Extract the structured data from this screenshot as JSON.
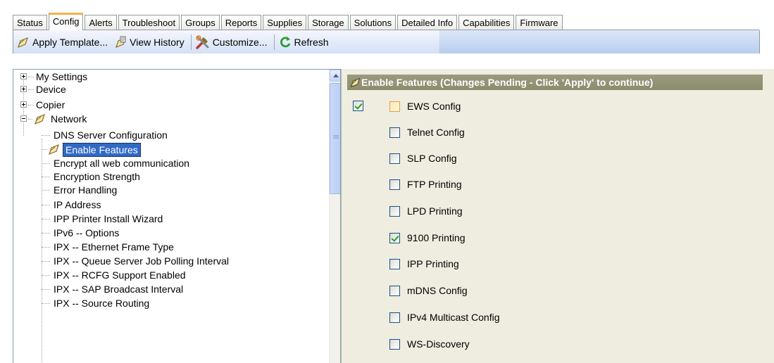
{
  "tabs": [
    "Status",
    "Config",
    "Alerts",
    "Troubleshoot",
    "Groups",
    "Reports",
    "Supplies",
    "Storage",
    "Solutions",
    "Detailed Info",
    "Capabilities",
    "Firmware"
  ],
  "active_tab": "Config",
  "toolbar": {
    "apply_template": "Apply Template...",
    "view_history": "View History",
    "customize": "Customize...",
    "refresh": "Refresh"
  },
  "tree": {
    "my_settings": "My Settings",
    "device": "Device",
    "copier": "Copier",
    "network": "Network",
    "children": [
      "DNS Server Configuration",
      "Enable Features",
      "Encrypt all web communication",
      "Encryption Strength",
      "Error Handling",
      "IP Address",
      "IPP Printer Install Wizard",
      "IPv6 -- Options",
      "IPX -- Ethernet Frame Type",
      "IPX -- Queue Server Job Polling Interval",
      "IPX -- RCFG Support Enabled",
      "IPX -- SAP Broadcast Interval",
      "IPX -- Source Routing"
    ],
    "selected": "Enable Features"
  },
  "panel": {
    "header": "Enable Features (Changes Pending - Click 'Apply' to continue)",
    "master_checked": true,
    "features": [
      {
        "label": "EWS Config",
        "checked": false,
        "pending": true
      },
      {
        "label": "Telnet Config",
        "checked": false,
        "pending": false
      },
      {
        "label": "SLP Config",
        "checked": false,
        "pending": false
      },
      {
        "label": "FTP Printing",
        "checked": false,
        "pending": false
      },
      {
        "label": "LPD Printing",
        "checked": false,
        "pending": false
      },
      {
        "label": "9100 Printing",
        "checked": true,
        "pending": false
      },
      {
        "label": "IPP Printing",
        "checked": false,
        "pending": false
      },
      {
        "label": "mDNS Config",
        "checked": false,
        "pending": false
      },
      {
        "label": "IPv4 Multicast Config",
        "checked": false,
        "pending": false
      },
      {
        "label": "WS-Discovery",
        "checked": false,
        "pending": false
      }
    ]
  }
}
